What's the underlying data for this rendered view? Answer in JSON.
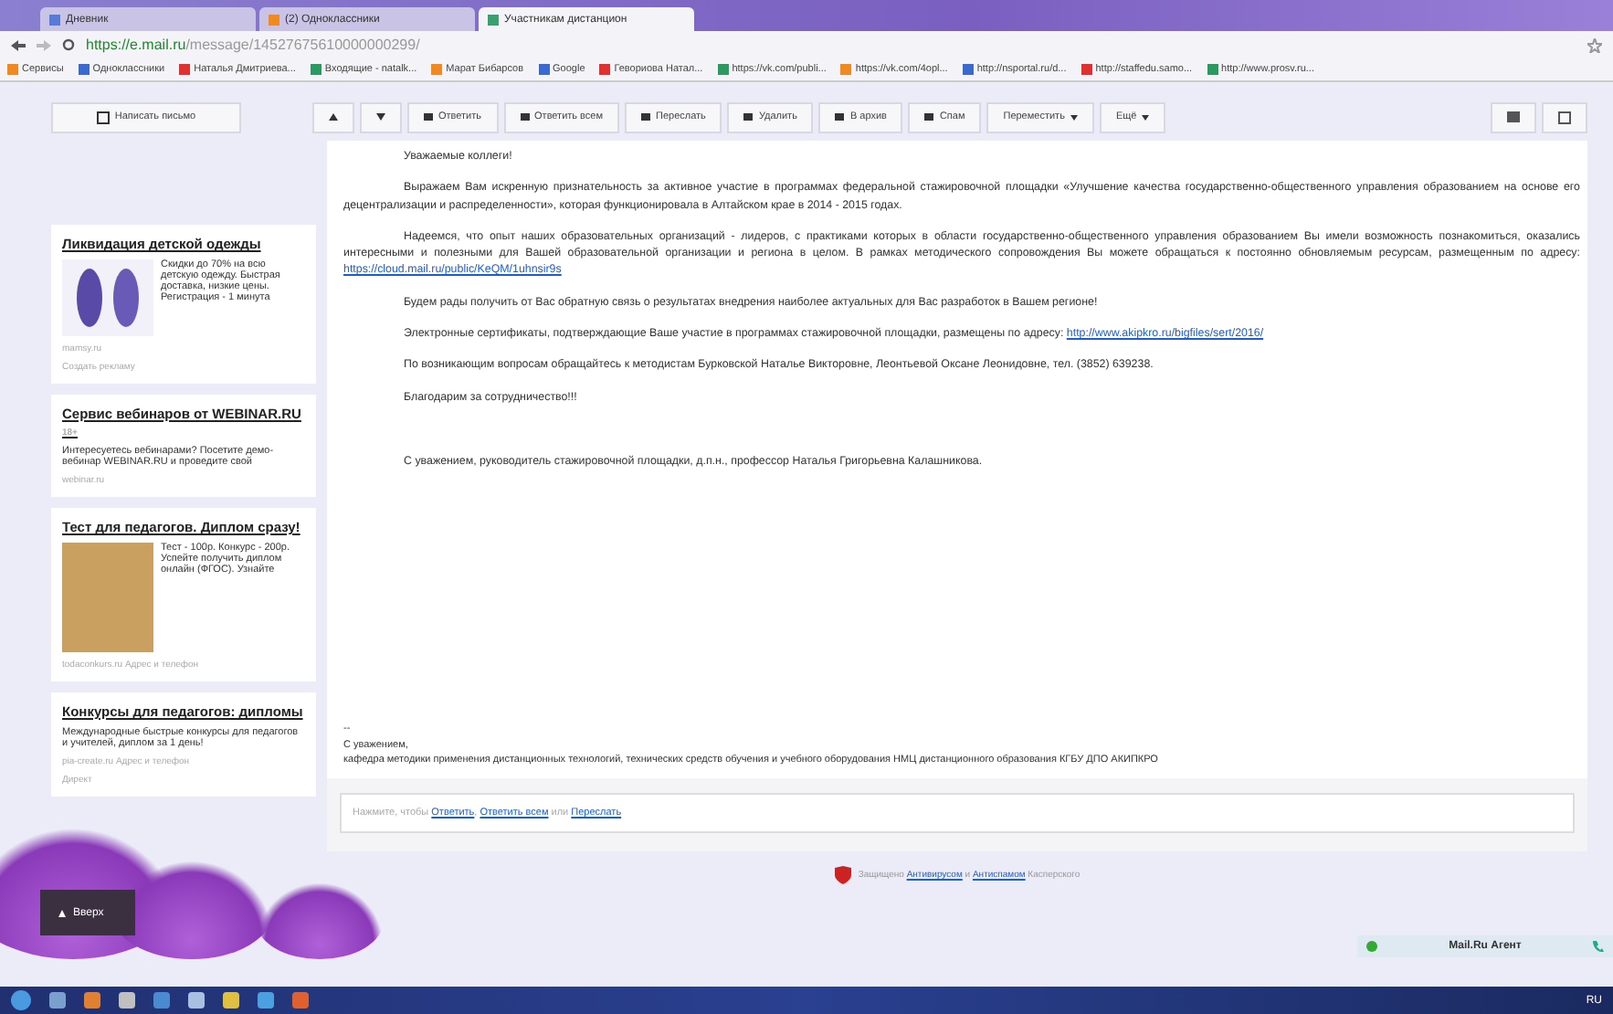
{
  "browser": {
    "tabs": [
      {
        "label": "Дневник",
        "selected": false
      },
      {
        "label": "(2) Одноклассники",
        "selected": false
      },
      {
        "label": "Участникам дистанцион",
        "selected": true
      }
    ],
    "url": {
      "host": "https://e.mail.ru",
      "path": "/message/14527675610000000299/"
    },
    "bookmarks": [
      "Сервисы",
      "Одноклассники",
      "Наталья Дмитриева...",
      "Входящие - natalk...",
      "Марат Бибарсов",
      "Google",
      "Гевориова Натал...",
      "https://vk.com/publi...",
      "https://vk.com/4opl...",
      "http://nsportal.ru/d...",
      "http://staffedu.samo...",
      "http://www.prosv.ru..."
    ]
  },
  "compose_button": "Написать письмо",
  "toolbar": [
    {
      "kind": "up"
    },
    {
      "kind": "down"
    },
    {
      "kind": "button",
      "label": "Ответить"
    },
    {
      "kind": "button",
      "label": "Ответить всем"
    },
    {
      "kind": "button",
      "label": "Переслать"
    },
    {
      "kind": "button",
      "label": "Удалить"
    },
    {
      "kind": "button",
      "label": "В архив"
    },
    {
      "kind": "button",
      "label": "Спам"
    },
    {
      "kind": "menu",
      "label": "Переместить"
    },
    {
      "kind": "menu",
      "label": "Ещё"
    }
  ],
  "ads": [
    {
      "kind": "product",
      "title": "Ликвидация детской одежды",
      "text": "Скидки до 70% на всю детскую одежду. Быстрая доставка, низкие цены. Регистрация - 1 минута",
      "domain": "mamsy.ru",
      "footer": "Создать рекламу"
    },
    {
      "kind": "service",
      "title": "Сервис вебинаров от WEBINAR.RU",
      "age": "18+",
      "text": "Интересуетесь вебинарами? Посетите демо-вебинар WEBINAR.RU и проведите свой",
      "domain": "webinar.ru"
    },
    {
      "kind": "teacher",
      "title": "Тест для педагогов. Диплом сразу!",
      "text": "Тест - 100р. Конкурс - 200р. Успейте получить диплом онлайн (ФГОС). Узнайте",
      "domain": "todaconkurs.ru",
      "extra": "Адрес и телефон"
    },
    {
      "kind": "contest",
      "title": "Конкурсы для педагогов: дипломы",
      "text": "Международные быстрые конкурсы для педагогов и учителей, диплом за 1 день!",
      "domain": "pia-create.ru",
      "extra": "Адрес и телефон",
      "footer": "Директ"
    }
  ],
  "message": {
    "greeting": "Уважаемые коллеги!",
    "paragraphs": [
      {
        "text": "Выражаем Вам искренную признательность за активное участие в программах федеральной стажировочной площадки «Улучшение качества государственно-общественного управления образованием на основе его децентрализации и распределенности», которая функционировала в Алтайском крае в 2014 - 2015 годах."
      },
      {
        "text": "Надеемся, что опыт наших образовательных организаций - лидеров, с практиками которых в области государственно-общественного управления образованием Вы имели возможность познакомиться, оказались интересными и полезными для Вашей образовательной организации и региона в целом. В рамках методического сопровождения Вы можете обращаться к постоянно обновляемым ресурсам, размещенным по адресу:",
        "link": "https://cloud.mail.ru/public/KeQM/1uhnsir9s"
      },
      {
        "text": "Будем рады получить от Вас обратную связь о результатах внедрения наиболее актуальных для Вас разработок в Вашем регионе!"
      },
      {
        "text": "Электронные сертификаты, подтверждающие Ваше участие в программах стажировочной площадки, размещены по адресу:",
        "link": "http://www.akipkro.ru/bigfiles/sert/2016/"
      },
      {
        "text": "По возникающим вопросам обращайтесь к методистам Бурковской Наталье Викторовне, Леонтьевой Оксане Леонидовне, тел. (3852) 639238."
      },
      {
        "text": "Благодарим за сотрудничество!!!"
      }
    ],
    "closing": "С уважением, руководитель стажировочной площадки, д.п.н., профессор  Наталья Григорьевна Калашникова.",
    "signature": [
      "--",
      "С уважением,",
      "кафедра методики применения дистанционных технологий, технических средств обучения и учебного оборудования НМЦ дистанционного образования КГБУ ДПО АКИПКРО"
    ]
  },
  "reply_prompt": [
    {
      "kind": "text",
      "text": "Нажмите, чтобы "
    },
    {
      "kind": "link",
      "text": "Ответить"
    },
    {
      "kind": "text",
      "text": ", "
    },
    {
      "kind": "link",
      "text": "Ответить всем"
    },
    {
      "kind": "text",
      "text": " или "
    },
    {
      "kind": "link",
      "text": "Переслать"
    }
  ],
  "protection": [
    {
      "kind": "text",
      "text": "Защищено "
    },
    {
      "kind": "link",
      "text": "Антивирусом"
    },
    {
      "kind": "text",
      "text": " и "
    },
    {
      "kind": "link",
      "text": "Антиспамом"
    },
    {
      "kind": "text",
      "text": " Касперского"
    }
  ],
  "up_button": "Вверх",
  "agent": "Mail.Ru Агент",
  "taskbar": {
    "language": "RU"
  }
}
